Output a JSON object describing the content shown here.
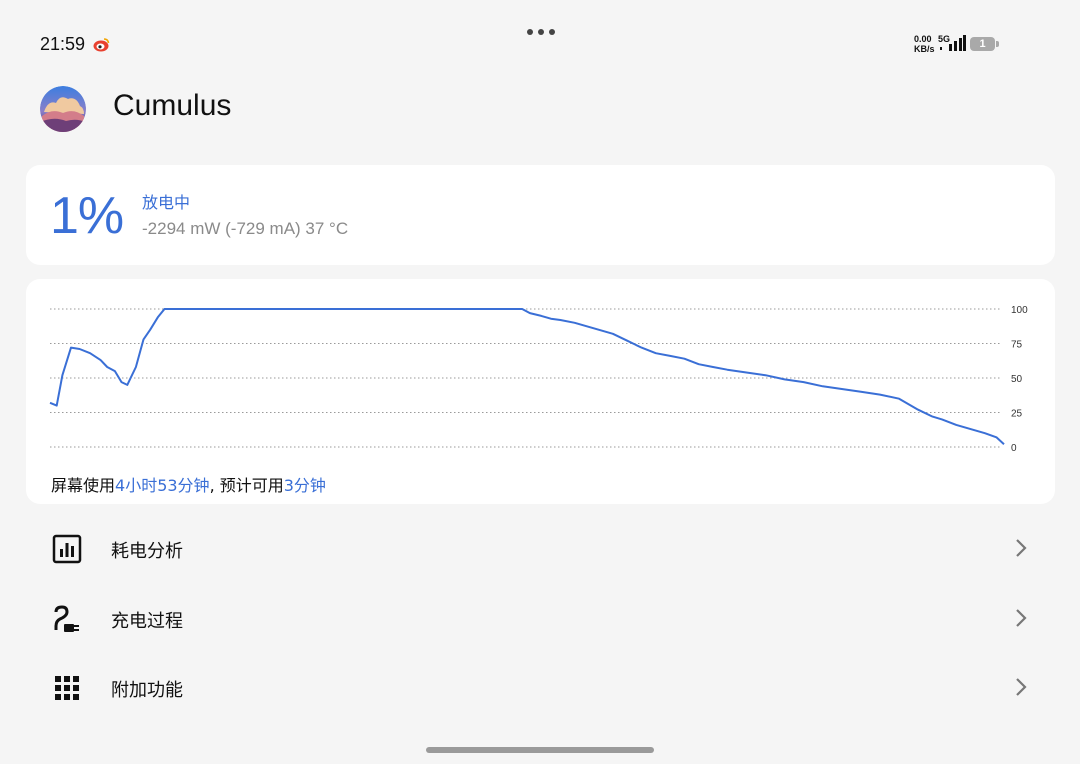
{
  "status_bar": {
    "time": "21:59",
    "net_speed_value": "0.00",
    "net_speed_unit": "KB/s",
    "network_type": "5G",
    "battery_level": "1",
    "notification_icon": "weibo-icon"
  },
  "header": {
    "title": "Cumulus"
  },
  "battery": {
    "percent": "1%",
    "state": "放电中",
    "stats": "-2294 mW (-729 mA) 37 °C"
  },
  "usage": {
    "prefix": "屏幕使用",
    "screen_time": "4小时53分钟",
    "middle": ", 预计可用",
    "remaining": "3分钟"
  },
  "chart_data": {
    "type": "line",
    "ylim": [
      0,
      100
    ],
    "yticks": [
      "100",
      "75",
      "50",
      "25",
      "0"
    ],
    "grid": true,
    "color": "#3a6fd6",
    "series": [
      {
        "x": [
          0,
          0.7,
          1.3,
          2.2,
          3.1,
          4.2,
          5.3,
          6.0,
          6.8,
          7.5,
          8.1,
          9.0,
          9.8,
          10.5,
          11.3,
          12.0,
          13.0,
          20.0,
          30.0,
          40.0,
          49.5,
          50.3,
          51.5,
          52.5,
          53.5,
          55.0,
          57.0,
          59.0,
          60.5,
          62.0,
          63.5,
          65.0,
          66.5,
          68.0,
          69.5,
          71.0,
          73.0,
          75.0,
          77.0,
          79.0,
          81.0,
          83.0,
          85.0,
          87.0,
          89.0,
          91.0,
          92.5,
          93.5,
          95.0,
          96.5,
          98.0,
          99.2,
          100
        ],
        "y": [
          32,
          30,
          52,
          72,
          71,
          68,
          63,
          58,
          55,
          47,
          45,
          58,
          78,
          85,
          94,
          100,
          100,
          100,
          100,
          100,
          100,
          97,
          95,
          93,
          92,
          90,
          86,
          82,
          77,
          72,
          68,
          66,
          64,
          60,
          58,
          56,
          54,
          52,
          49,
          47,
          44,
          42,
          40,
          38,
          35,
          27,
          22,
          20,
          16,
          13,
          10,
          7,
          2
        ]
      }
    ]
  },
  "menu": [
    {
      "label": "耗电分析",
      "icon": "bar-chart-icon"
    },
    {
      "label": "充电过程",
      "icon": "charging-plug-icon"
    },
    {
      "label": "附加功能",
      "icon": "grid-apps-icon"
    }
  ],
  "colors": {
    "accent": "#3a6fd6",
    "background": "#f5f5f5",
    "card": "#ffffff"
  }
}
